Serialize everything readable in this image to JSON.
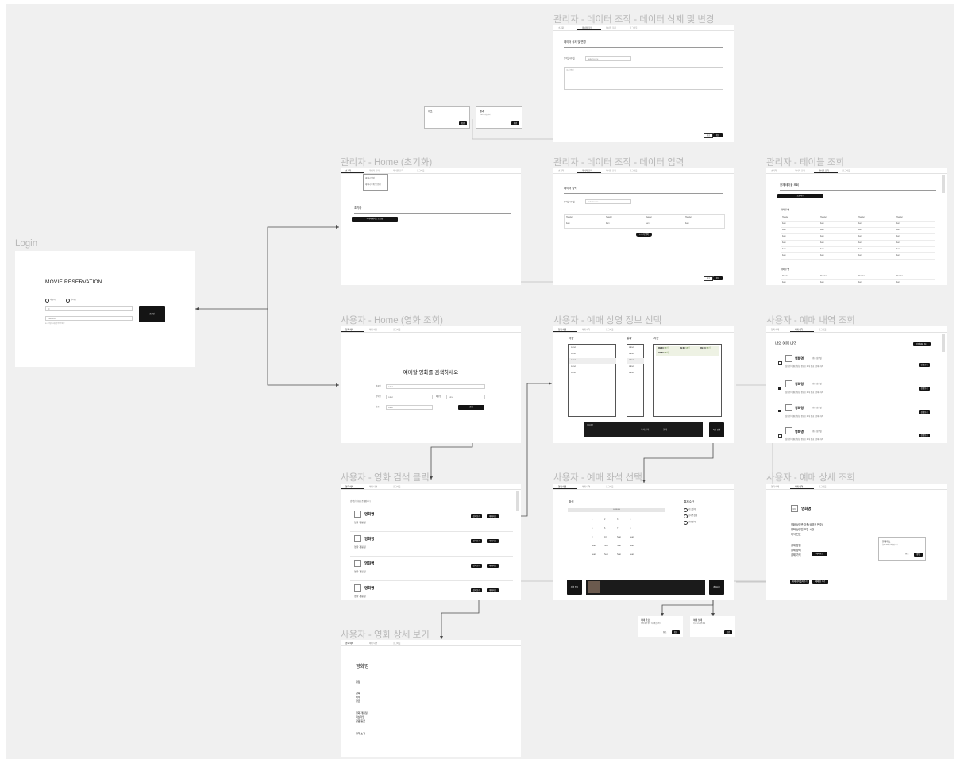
{
  "frames": {
    "login": {
      "title": "Login",
      "heading": "MOVIE RESERVATION",
      "radio_user": "사용자",
      "radio_admin": "관리자",
      "id_placeholder": "ID",
      "password_placeholder": "Password",
      "hint": "ID / 비밀번호를 입력해주세요",
      "login_button": "로그인"
    },
    "admin_delete": {
      "title": "관리자 - 데이터 조작 - 데이터 삭제 및 변경",
      "tabs": [
        "초기화",
        "데이터 조작",
        "테이블 조회",
        "로그아웃"
      ],
      "section": "데이터 삭제 및 변경",
      "table_label": "입력할 테이블",
      "select_value": "Select a one",
      "textarea_placeholder": "조건 입력",
      "cancel": "취소",
      "confirm": "확인"
    },
    "modal_cancel": {
      "title": "취소",
      "button": "확인"
    },
    "modal_result": {
      "title": "결과",
      "body": "변경 되었습니다",
      "button": "확인"
    },
    "admin_home": {
      "title": "관리자 - Home (초기화)",
      "tabs": [
        "초기화",
        "데이터 조작",
        "테이블 조회",
        "로그아웃"
      ],
      "dropdown_items": [
        "데이터 입력",
        "데이터 삭제 및 변경"
      ],
      "section": "초기화",
      "init_button": "데이터베이스 초기화"
    },
    "admin_insert": {
      "title": "관리자 - 데이터 조작 - 데이터 입력",
      "tabs": [
        "초기화",
        "데이터 조작",
        "테이블 조회",
        "로그아웃"
      ],
      "section": "데이터 입력",
      "table_label": "입력할 테이블",
      "select_value": "Select a one",
      "headers": [
        "Header",
        "Header",
        "Header",
        "Header"
      ],
      "row": [
        "Item",
        "Item",
        "Item",
        "Item"
      ],
      "add_row": "+ 추가 입력",
      "cancel": "취소",
      "confirm": "확인"
    },
    "admin_tables": {
      "title": "관리자 - 테이블 조회",
      "tabs": [
        "초기화",
        "데이터 조작",
        "테이블 조회",
        "로그아웃"
      ],
      "section": "전체 테이블 조회",
      "button": "조회하기",
      "table1": "테이블 명",
      "table2": "테이블 명",
      "headers": [
        "Header",
        "Header",
        "Header",
        "Header"
      ],
      "cell": "Item"
    },
    "user_home": {
      "title": "사용자 - Home (영화 조회)",
      "tabs": [
        "영화 예매",
        "예매 내역",
        "로그아웃"
      ],
      "heading": "예매할 영화를 검색하세요",
      "fields": [
        "영화명",
        "감독명",
        "배우명",
        "장르"
      ],
      "field_value": "Label",
      "extra_label": "개봉일",
      "search_button": "검색"
    },
    "user_showtime": {
      "title": "사용자 - 예매 상영 정보 선택",
      "tabs": [
        "영화 예매",
        "예매 내역",
        "로그아웃"
      ],
      "col_theater": "극장",
      "col_date": "날짜",
      "col_time": "시간",
      "list_label": "Label",
      "date_label": "Label",
      "times": [
        {
          "time": "09:30",
          "seats": "98석"
        },
        {
          "time": "09:30",
          "seats": "98석"
        },
        {
          "time": "09:30",
          "seats": "98석"
        },
        {
          "time": "22:50",
          "seats": "98석"
        }
      ],
      "summary_movie": "영화제목",
      "summary_seat": "좌석선택",
      "summary_pay": "결제",
      "next": "좌석 선택"
    },
    "user_history": {
      "title": "사용자 - 예매 내역 조회",
      "tabs": [
        "영화 예매",
        "예매 내역",
        "로그아웃"
      ],
      "heading": "나의 예매 내역",
      "cancel_all": "선택 예매 취소",
      "items": [
        {
          "movie": "영화명",
          "state": "영화 상영일",
          "desc": "상영관 이름(상영관 번호) | 좌석 번호 | 판매 가격",
          "btn": "상세보기"
        },
        {
          "movie": "영화명",
          "state": "영화 상영일",
          "desc": "상영관 이름(상영관 번호) | 좌석 번호 | 판매 가격",
          "btn": "상세보기"
        },
        {
          "movie": "영화명",
          "state": "영화 상영일",
          "desc": "상영관 이름(상영관 번호) | 좌석 번호 | 판매 가격",
          "btn": "상세보기"
        },
        {
          "movie": "영화명",
          "state": "영화 상영일",
          "desc": "상영관 이름(상영관 번호) | 좌석 번호 | 판매 가격",
          "btn": "상세보기"
        }
      ]
    },
    "user_search": {
      "title": "사용자 - 영화 검색 클릭",
      "tabs": [
        "영화 예매",
        "예매 내역",
        "로그아웃"
      ],
      "caption": "검색된 영화가 존재합니다",
      "items": [
        {
          "movie": "영화명",
          "date": "영화 개봉일",
          "b1": "상세보기",
          "b2": "예매하기"
        },
        {
          "movie": "영화명",
          "date": "영화 개봉일",
          "b1": "상세보기",
          "b2": "예매하기"
        },
        {
          "movie": "영화명",
          "date": "영화 개봉일",
          "b1": "상세보기",
          "b2": "예매하기"
        },
        {
          "movie": "영화명",
          "date": "영화 개봉일",
          "b1": "상세보기",
          "b2": "예매하기"
        }
      ]
    },
    "user_seat": {
      "title": "사용자 - 예매 좌석 선택",
      "tabs": [
        "영화 예매",
        "예매 내역",
        "로그아웃"
      ],
      "seat_label": "좌석",
      "screen": "SCREEN",
      "pay_label": "결제수단",
      "pay_options": [
        "카드결제",
        "휴대폰결제",
        "간편결제"
      ],
      "prev": "상영 정보",
      "next": "결제하기",
      "seat_numbers": [
        "1",
        "2",
        "3",
        "4",
        "5",
        "6",
        "7",
        "8",
        "9",
        "10",
        "Seat",
        "Seat"
      ]
    },
    "modal_pay_ok": {
      "title": "예매 완료",
      "body": "예매 내역 확인 하시겠습니까?",
      "cancel": "취소",
      "ok": "확인"
    },
    "modal_pay_fail": {
      "title": "예매 실패",
      "body": "다시 시도해주세요",
      "ok": "확인"
    },
    "user_detail": {
      "title": "사용자 - 예매 상세 조회",
      "poster": "IMG",
      "movie": "영화명",
      "lines": [
        "영화 상영관 이름(상영관 번호)",
        "영화 상영일 요일 시간",
        "좌석 번호"
      ],
      "pay_lines": [
        "결제 방법",
        "결제 상태",
        "결제 가격"
      ],
      "cancel_btn": "예매취소",
      "popup_title": "결제취소",
      "popup_body": "결제 금액이 환불됩니다",
      "popup_cancel": "취소",
      "popup_ok": "확인",
      "back_btn": "예매 내역 돌아가기",
      "home_btn": "예매 창 가기"
    },
    "movie_detail": {
      "title": "사용자 - 영화 상세 보기",
      "tabs": [
        "영화 예매",
        "예매 내역",
        "로그아웃"
      ],
      "movie": "영화명",
      "rating": "평점",
      "people": [
        "감독",
        "배우",
        "장르"
      ],
      "info": [
        "영화 개봉일",
        "러닝타임",
        "관람 등급"
      ],
      "synopsis": "영화 소개"
    }
  },
  "colors": {
    "canvas": "#f0f0f0",
    "frame": "#ffffff",
    "title": "#b9b9b9",
    "dark": "#141414",
    "wire": "#4a4a4a",
    "wire_light": "#bdbdbd"
  }
}
